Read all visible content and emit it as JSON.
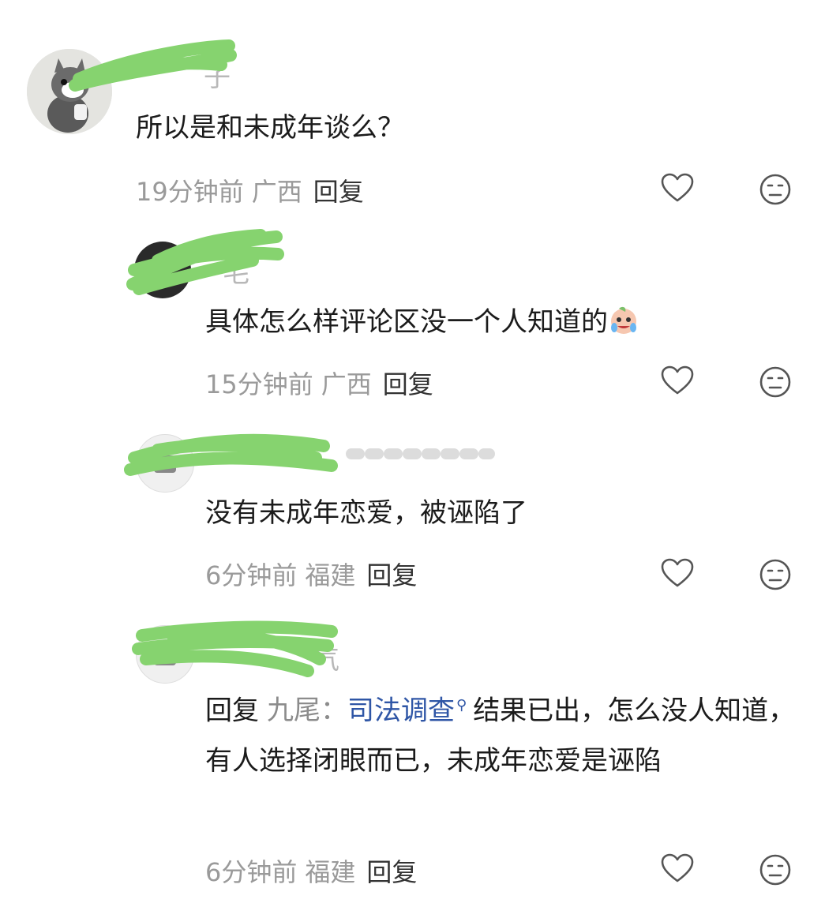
{
  "comments": [
    {
      "username": "子",
      "text": "所以是和未成年谈么？",
      "time": "19分钟前",
      "region": "广西",
      "reply_label": "回复"
    },
    {
      "username": "毛",
      "text": "具体怎么样评论区没一个人知道的",
      "emoji": "crying-face-emoji",
      "time": "15分钟前",
      "region": "广西",
      "reply_label": "回复"
    },
    {
      "username": "",
      "text": "没有未成年恋爱，被诬陷了",
      "time": "6分钟前",
      "region": "福建",
      "reply_label": "回复"
    },
    {
      "username": "气",
      "reply_prefix": "回复",
      "reply_target": "九尾：",
      "topic_link": "司法调查",
      "text": "结果已出，怎么没人知道，有人选择闭眼而已，未成年恋爱是诬陷",
      "time": "6分钟前",
      "region": "福建",
      "reply_label": "回复"
    }
  ],
  "icons": {
    "like": "heart-outline-icon",
    "dislike": "neutral-face-icon",
    "search": "search-icon"
  },
  "colors": {
    "redaction": "#86d36f",
    "link": "#2f56a6",
    "meta": "#9a9a9a"
  }
}
